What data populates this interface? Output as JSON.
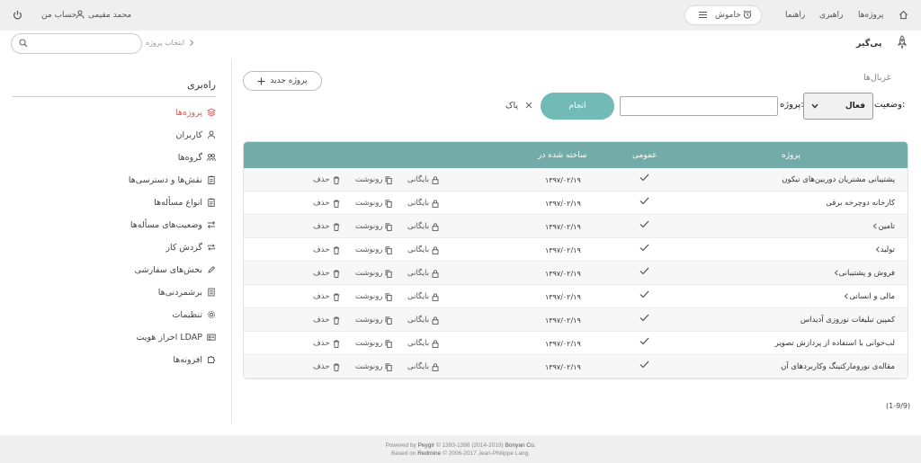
{
  "header": {
    "user_name": "محمد مقیمی",
    "my_account": "حساب من",
    "nav_projects": "پروژه‌ها",
    "nav_admin": "راهبری",
    "nav_help": "راهنما",
    "status_label": "خاموش",
    "brand": "پی‌گیر",
    "project_jump": "انتخاب پروژه"
  },
  "sidebar": {
    "title": "راه‌بری",
    "items": [
      {
        "label": "پروژه‌ها",
        "icon": "layers-icon"
      },
      {
        "label": "کاربران",
        "icon": "user-icon"
      },
      {
        "label": "گروه‌ها",
        "icon": "group-icon"
      },
      {
        "label": "نقش‌ها و دسترسی‌ها",
        "icon": "clipboard-icon"
      },
      {
        "label": "انواع مسأله‌ها",
        "icon": "clipboard-icon"
      },
      {
        "label": "وضعیت‌های مسأله‌ها",
        "icon": "swap-icon"
      },
      {
        "label": "گردش کار",
        "icon": "repeat-icon"
      },
      {
        "label": "بخش‌های سفارشی",
        "icon": "pencil-icon"
      },
      {
        "label": "برشمردنی‌ها",
        "icon": "list-icon"
      },
      {
        "label": "تنظیمات",
        "icon": "gear-icon"
      },
      {
        "label": "احراز هویت LDAP",
        "icon": "id-card-icon"
      },
      {
        "label": "افزونه‌ها",
        "icon": "puzzle-icon"
      }
    ]
  },
  "filters": {
    "legend": "غربال‌ها",
    "status_label": "وضعیت:",
    "status_value": "فعال",
    "project_label": "پروژه:",
    "apply": "انجام",
    "clear": "پاک"
  },
  "actions": {
    "new_project": "پروژه جدید",
    "archive": "بایگانی",
    "copy": "رونوشت",
    "delete": "حذف"
  },
  "table": {
    "headers": {
      "project": "پروژه",
      "public": "عمومی",
      "created": "ساخته شده در"
    },
    "rows": [
      {
        "name": "پشتیبانی مشتریان دوربین‌های نیکون",
        "date": "۱۳۹۷/۰۲/۱۹",
        "expandable": false
      },
      {
        "name": "کارخانه دوچرخه برقی",
        "date": "۱۳۹۷/۰۲/۱۹",
        "expandable": false
      },
      {
        "name": "تامین",
        "date": "۱۳۹۷/۰۲/۱۹",
        "expandable": true
      },
      {
        "name": "تولید",
        "date": "۱۳۹۷/۰۲/۱۹",
        "expandable": true
      },
      {
        "name": "فروش و پشتیبانی",
        "date": "۱۳۹۷/۰۲/۱۹",
        "expandable": true
      },
      {
        "name": "مالی و انسانی",
        "date": "۱۳۹۷/۰۲/۱۹",
        "expandable": true
      },
      {
        "name": "کمپین تبلیغات نوروزی آدیداس",
        "date": "۱۳۹۷/۰۲/۱۹",
        "expandable": false
      },
      {
        "name": "لب‌خوانی با استفاده از پردازش تصویر",
        "date": "۱۳۹۷/۰۲/۱۹",
        "expandable": false
      },
      {
        "name": "مقاله‌ی نورومارکتینگ وکاربردهای آن",
        "date": "۱۳۹۷/۰۲/۱۹",
        "expandable": false
      }
    ]
  },
  "pagination": "(1-9/9)",
  "footer": {
    "line1_pre": "Powered by",
    "line1_brand": "Peygir",
    "line1_post": "© 1393-1398 (2014-2019)",
    "line1_company": "Bonyan Co.",
    "line2_pre": "Based on",
    "line2_brand": "Redmine",
    "line2_post": "© 2006-2017 Jean-Philippe Lang."
  },
  "colors": {
    "accent": "#72bab6",
    "header_teal": "#72aba7",
    "active": "#e05555"
  }
}
